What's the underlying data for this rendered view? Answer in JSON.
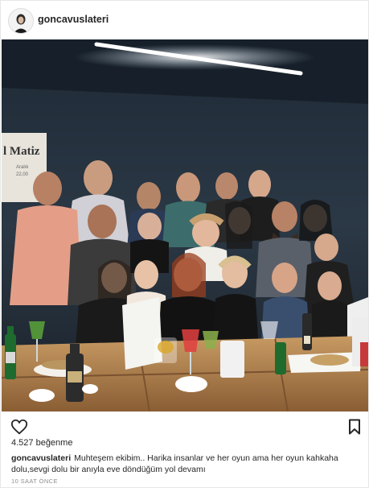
{
  "post": {
    "username": "goncavuslateri",
    "likes": "4.527 beğenme",
    "caption_user": "goncavuslateri",
    "caption_text": "Muhteşem ekibim.. Harika insanlar ve her oyun ama her oyun kahkaha dolu,sevgi dolu bir anıyla eve döndüğüm yol devamı",
    "time": "10 SAAT ÖNCE"
  },
  "photo": {
    "poster_text": "l Matiz",
    "poster_small": "Aralık",
    "poster_price": "22,00",
    "description_icon": "group-photo"
  },
  "icons": {
    "like": "heart-icon",
    "save": "bookmark-icon"
  }
}
